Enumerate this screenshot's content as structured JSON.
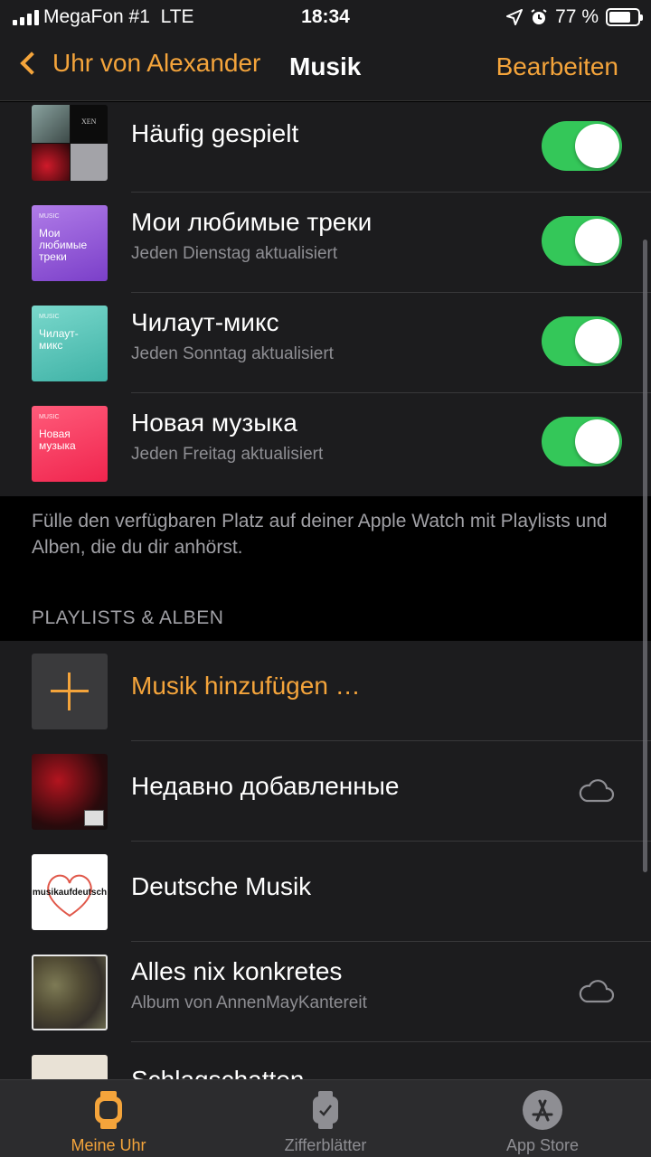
{
  "status_bar": {
    "carrier": "MegaFon #1",
    "network": "LTE",
    "time": "18:34",
    "battery": "77 %",
    "battery_level": 0.77
  },
  "nav": {
    "back_label": "Uhr von Alexander",
    "title": "Musik",
    "edit_label": "Bearbeiten"
  },
  "auto_playlists": [
    {
      "title": "Häufig gespielt",
      "subtitle": "",
      "enabled": true
    },
    {
      "title": "Мои любимые треки",
      "subtitle": "Jeden Dienstag aktualisiert",
      "enabled": true,
      "art_text": "Мои любимые треки",
      "art_tag": "MUSIC"
    },
    {
      "title": "Чилаут-микс",
      "subtitle": "Jeden Sonntag aktualisiert",
      "enabled": true,
      "art_text": "Чилаут-микс",
      "art_tag": "MUSIC"
    },
    {
      "title": "Новая музыка",
      "subtitle": "Jeden Freitag aktualisiert",
      "enabled": true,
      "art_text": "Новая музыка",
      "art_tag": "MUSIC"
    }
  ],
  "footer_text": "Fülle den verfügbaren Platz auf deiner Apple Watch mit Playlists und Alben, die du dir anhörst.",
  "section_header": "PLAYLISTS & ALBEN",
  "add_music_label": "Musik hinzufügen …",
  "playlists": [
    {
      "title": "Недавно добавленные",
      "subtitle": "",
      "icon": "cloud-icon"
    },
    {
      "title": "Deutsche Musik",
      "subtitle": "",
      "art_text": "musikaufdeutsch"
    },
    {
      "title": "Alles nix konkretes",
      "subtitle": "Album von AnnenMayKantereit",
      "icon": "cloud-icon"
    },
    {
      "title": "Schlagschatten",
      "subtitle": ""
    }
  ],
  "tabs": [
    {
      "label": "Meine Uhr",
      "active": true
    },
    {
      "label": "Zifferblätter",
      "active": false
    },
    {
      "label": "App Store",
      "active": false
    }
  ],
  "colors": {
    "accent": "#f4a43b",
    "toggle_on": "#34c759",
    "cell_bg": "#1c1c1e",
    "secondary_text": "#8e8e93"
  }
}
